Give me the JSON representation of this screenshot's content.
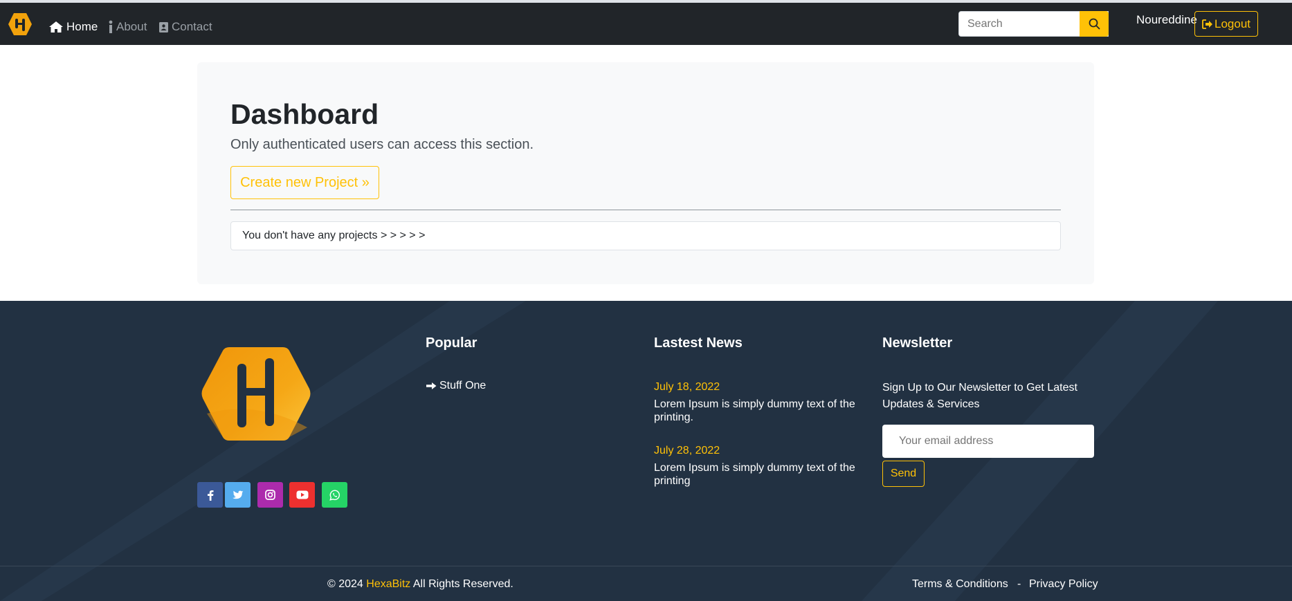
{
  "nav": {
    "home": "Home",
    "about": "About",
    "contact": "Contact",
    "search_placeholder": "Search",
    "username": "Noureddine",
    "logout": "Logout"
  },
  "dashboard": {
    "title": "Dashboard",
    "lead": "Only authenticated users can access this section.",
    "create_button": "Create new Project »",
    "empty_message": "You don't have any projects > > > > >"
  },
  "footer": {
    "popular": {
      "title": "Popular",
      "items": [
        "Stuff One"
      ]
    },
    "news": {
      "title": "Lastest News",
      "items": [
        {
          "date": "July 18, 2022",
          "text": "Lorem Ipsum is simply dummy text of the printing."
        },
        {
          "date": "July 28, 2022",
          "text": "Lorem Ipsum is simply dummy text of the printing"
        }
      ]
    },
    "newsletter": {
      "title": "Newsletter",
      "text": "Sign Up to Our Newsletter to Get Latest Updates & Services",
      "placeholder": "Your email address",
      "send": "Send"
    },
    "social": [
      {
        "icon": "facebook-icon",
        "color": "#3b5998"
      },
      {
        "icon": "twitter-icon",
        "color": "#55acee"
      },
      {
        "icon": "instagram-icon",
        "color": "#ac2bac"
      },
      {
        "icon": "youtube-icon",
        "color": "#ed302f"
      },
      {
        "icon": "whatsapp-icon",
        "color": "#25d366"
      }
    ],
    "copyright_prefix": "© 2024",
    "brand": "HexaBitz",
    "copyright_suffix": "All Rights Reserved.",
    "terms": "Terms & Conditions",
    "separator": "-",
    "privacy": "Privacy Policy"
  },
  "colors": {
    "accent": "#ffc107",
    "navbar": "#212529",
    "footer": "#223142"
  }
}
